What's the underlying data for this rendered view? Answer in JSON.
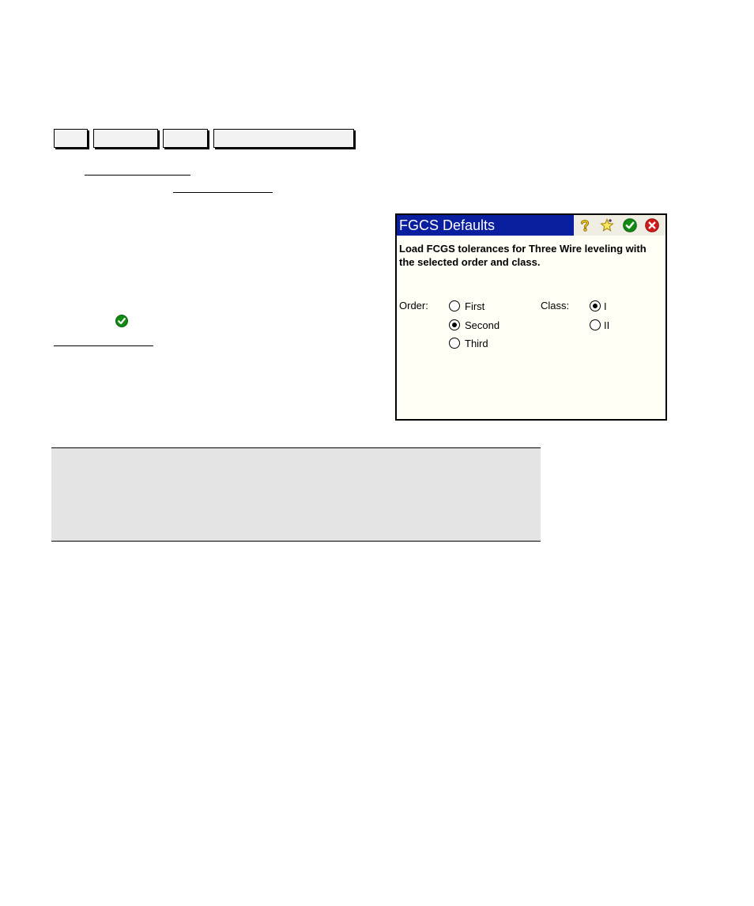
{
  "dialog": {
    "title": "FGCS Defaults",
    "description": "Load FCGS tolerances for Three Wire leveling with the selected order and class.",
    "toolbar_icons": [
      "help-icon",
      "favorites-star-icon",
      "ok-check-icon",
      "cancel-close-icon"
    ],
    "order": {
      "label": "Order:",
      "options": [
        "First",
        "Second",
        "Third"
      ],
      "selected": "Second"
    },
    "class": {
      "label": "Class:",
      "options": [
        "I",
        "II"
      ],
      "selected": "I"
    }
  },
  "icons": {
    "inline_check": "ok-check-icon"
  },
  "colors": {
    "titlebar": "#0a1ea0",
    "dialog_bg": "#fffff6",
    "ok_green": "#138a13",
    "cancel_red": "#d11a1a",
    "note_bg": "#e4e4e4"
  }
}
